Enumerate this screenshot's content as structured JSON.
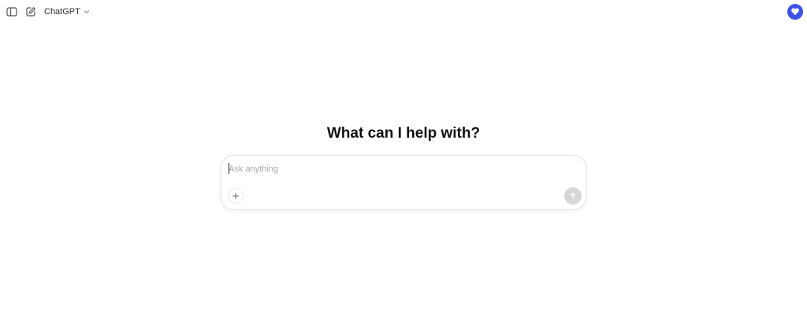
{
  "header": {
    "model_name": "ChatGPT",
    "icons": {
      "sidebar_toggle": "sidebar-toggle-icon",
      "new_chat": "new-chat-icon",
      "model_dropdown": "chevron-down-icon",
      "profile": "heart-badge-icon"
    },
    "colors": {
      "profile_badge": "#3e52e8"
    }
  },
  "main": {
    "title": "What can I help with?",
    "composer": {
      "placeholder": "Ask anything",
      "value": "",
      "attach_icon": "plus-icon",
      "send_icon": "arrow-up-icon",
      "send_color": "#d7d7d7"
    }
  }
}
